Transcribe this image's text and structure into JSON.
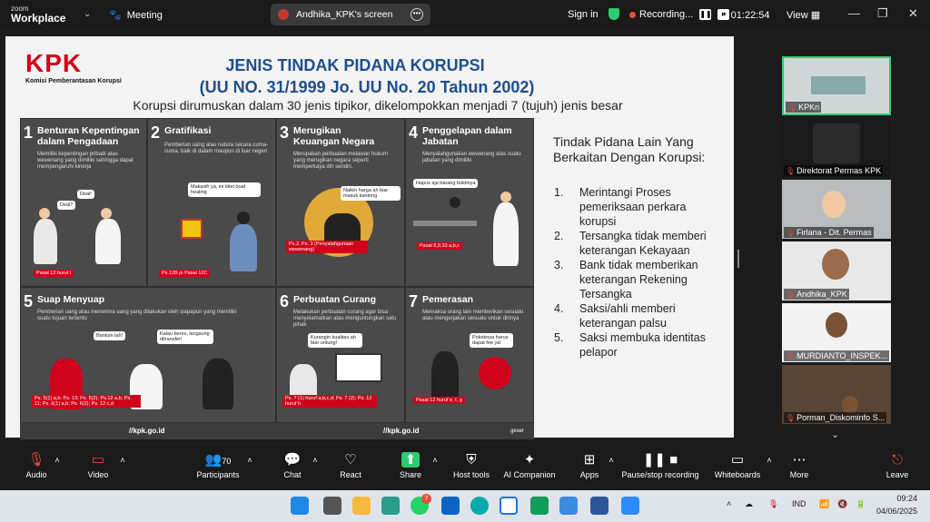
{
  "app": {
    "logo_top": "zoom",
    "logo_bottom": "Workplace",
    "meeting": "Meeting",
    "screen_label": "Andhika_KPK's screen",
    "signin": "Sign in",
    "recording": "Recording...",
    "timer": "01:22:54",
    "view": "View"
  },
  "slide": {
    "logo": "KPK",
    "logo_sub": "Komisi Pemberantasan Korupsi",
    "title1": "JENIS TINDAK PIDANA KORUPSI",
    "title2": "(UU NO. 31/1999 Jo. UU No. 20 Tahun 2002)",
    "subtitle": "Korupsi dirumuskan dalam 30 jenis tipikor, dikelompokkan menjadi 7 (tujuh) jenis besar",
    "cells": [
      {
        "n": "1",
        "h": "Benturan Kepentingan dalam Pengadaan",
        "d": "Memiliki kepentingan pribadi atas wewenang yang dimiliki sehingga dapat mempengaruhi kinerja",
        "law": "Pasal 12 huruf i",
        "b1": "Deal?",
        "b2": "Deal!"
      },
      {
        "n": "2",
        "h": "Gratifikasi",
        "d": "Pemberian uang atau natura secara cuma-cuma, baik di dalam maupun di luar negeri",
        "law": "Ps.12B jo Pasal 12C",
        "b1": "Makasih ya, ini tiket buat healing"
      },
      {
        "n": "3",
        "h": "Merugikan Keuangan Negara",
        "d": "Merupakan perbuatan melawan hukum yang merugikan negara seperti memperkaya diri sendiri.",
        "law": "Ps.2, Ps. 3 (Penyalahgunaan wewenang)",
        "b1": "Naikin harga ah biar masuk kantong"
      },
      {
        "n": "4",
        "h": "Penggelapan dalam Jabatan",
        "d": "Menyalahgunakan wewenang atas suatu jabatan yang dimiliki",
        "law": "Pasal 8,9,10 a,b,c",
        "b1": "Hapus aja barang buktinya"
      },
      {
        "n": "5",
        "h": "Suap Menyuap",
        "d": "Pemberian uang atau menerima uang yang dilakukan oleh siapapun yang memiliki suatu tujuan tertentu",
        "law": "Ps. 5(1) a,b; Ps. 13; Ps. 5(2); Ps.12 a,b; Ps. 11; Ps. 6(1) a,b; Ps. 6(2); Ps. 12 c,d",
        "b1": "Bantuin lah!",
        "b2": "Kalau beres, langsung ditransfer!"
      },
      {
        "n": "6",
        "h": "Perbuatan Curang",
        "d": "Melakukan perbuatan curang agar bisa menyelamatkan atau menguntungkan satu pihak",
        "law": "Ps. 7 (1) huruf a,b,c,d; Ps. 7 (2); Ps. 12 huruf h",
        "b1": "Kurangin kualitas ah biar untung!"
      },
      {
        "n": "7",
        "h": "Pemerasan",
        "d": "Memaksa orang lain memberikan sesuatu atau mengerjakan sesuatu untuk dirinya",
        "law": "Pasal 12 huruf e, f, g",
        "b1": "Pokoknya harus dapat fee ya!"
      }
    ],
    "url1": "//kpk.go.id",
    "url2": "//kpk.go.id",
    "brand": "geser",
    "side_title": "Tindak Pidana Lain Yang Berkaitan Dengan Korupsi:",
    "list": [
      {
        "n": "1.",
        "t": "Merintangi Proses pemeriksaan perkara korupsi"
      },
      {
        "n": "2.",
        "t": "Tersangka tidak memberi keterangan Kekayaan"
      },
      {
        "n": "3.",
        "t": "Bank tidak memberikan keterangan Rekening Tersangka"
      },
      {
        "n": "4.",
        "t": "Saksi/ahli memberi keterangan palsu"
      },
      {
        "n": "5.",
        "t": "Saksi membuka identitas pelapor"
      }
    ]
  },
  "participants": [
    {
      "name": "KPKri"
    },
    {
      "name": "Direktorat Permas KPK"
    },
    {
      "name": "Firlana - Dit. Permas"
    },
    {
      "name": "Andhika_KPK"
    },
    {
      "name": "MURDIANTO_INSPEK..."
    },
    {
      "name": "Porman_Diskominfo S..."
    }
  ],
  "toolbar": {
    "audio": "Audio",
    "video": "Video",
    "participants": "Participants",
    "participants_count": "70",
    "chat": "Chat",
    "react": "React",
    "share": "Share",
    "host": "Host tools",
    "ai": "AI Companion",
    "apps": "Apps",
    "pause": "Pause/stop recording",
    "whiteboards": "Whiteboards",
    "more": "More",
    "leave": "Leave"
  },
  "taskbar": {
    "lang": "IND",
    "time": "09:24",
    "date": "04/06/2025",
    "badge": "7"
  },
  "colors": {
    "accent": "#1f4e8c",
    "brand_red": "#d0021b",
    "share_green": "#2ecc71",
    "leave_red": "#e74c3c"
  }
}
